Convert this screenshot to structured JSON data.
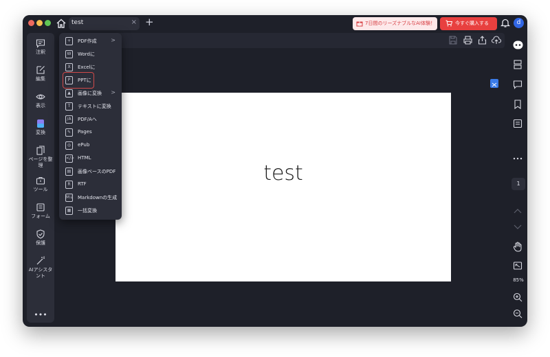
{
  "tab": {
    "label": "test",
    "close": "×",
    "new": "+"
  },
  "promo": {
    "label": "7日間のリーズナブルなAI体験！"
  },
  "buy": {
    "label": "今すぐ購入する"
  },
  "user": {
    "avatar": "d"
  },
  "sidebar": {
    "items": [
      {
        "label": "注釈",
        "icon": "comment-icon"
      },
      {
        "label": "編集",
        "icon": "edit-icon"
      },
      {
        "label": "表示",
        "icon": "eye-icon"
      },
      {
        "label": "変換",
        "icon": "convert-icon"
      },
      {
        "label": "ページを整理",
        "icon": "pages-icon"
      },
      {
        "label": "ツール",
        "icon": "toolbox-icon"
      },
      {
        "label": "フォーム",
        "icon": "form-icon"
      },
      {
        "label": "保護",
        "icon": "shield-icon"
      },
      {
        "label": "AIアシスタント",
        "icon": "ai-wand-icon"
      }
    ],
    "more": "•••"
  },
  "convert_menu": {
    "items": [
      {
        "label": "PDF作成",
        "icon": "+",
        "arrow": ">"
      },
      {
        "label": "Wordに",
        "icon": "W"
      },
      {
        "label": "Excelに",
        "icon": "X"
      },
      {
        "label": "PPTに",
        "icon": "P"
      },
      {
        "label": "画像に変換",
        "icon": "▲",
        "arrow": ">"
      },
      {
        "label": "テキストに変換",
        "icon": "T"
      },
      {
        "label": "PDF/Aへ",
        "icon": "/A"
      },
      {
        "label": "Pages",
        "icon": "✎"
      },
      {
        "label": "ePub",
        "icon": "◎"
      },
      {
        "label": "HTML",
        "icon": "</>"
      },
      {
        "label": "画像ベースのPDF",
        "icon": "▤"
      },
      {
        "label": "RTF",
        "icon": "R"
      },
      {
        "label": "Markdownの生成",
        "icon": "M↓"
      },
      {
        "label": "一括変換",
        "icon": "▦"
      }
    ]
  },
  "document": {
    "text": "test"
  },
  "page_nav": {
    "current": "1"
  },
  "zoom": {
    "level": "85%"
  },
  "colors": {
    "accent": "#e8403f",
    "avatar": "#3166e4",
    "promo_bg": "#fde9ea"
  }
}
